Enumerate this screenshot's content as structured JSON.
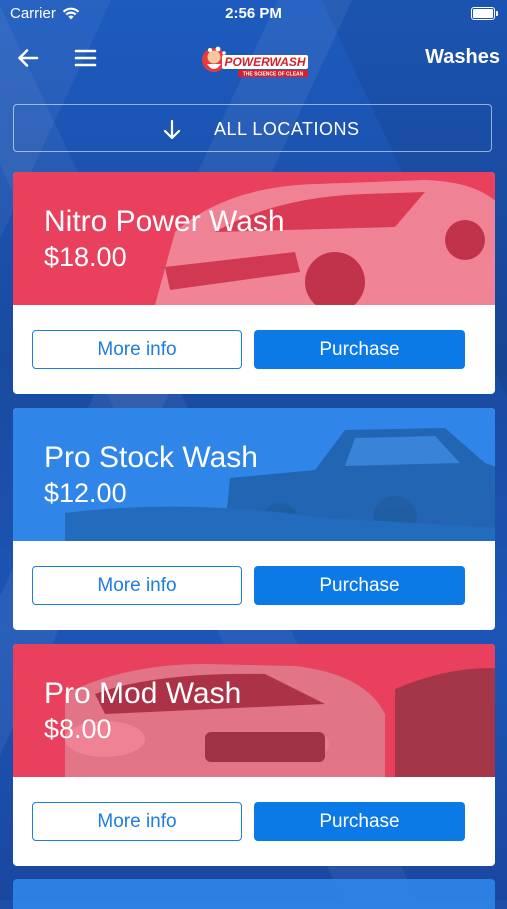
{
  "status_bar": {
    "carrier": "Carrier",
    "time": "2:56 PM"
  },
  "nav": {
    "title": "Washes",
    "logo_text": "POWERWASH",
    "logo_tagline": "THE SCIENCE OF CLEAN"
  },
  "location_filter": {
    "label": "ALL LOCATIONS"
  },
  "washes": [
    {
      "name": "Nitro Power Wash",
      "price": "$18.00",
      "color": "#e8405d",
      "more_info_label": "More info",
      "purchase_label": "Purchase"
    },
    {
      "name": "Pro Stock Wash",
      "price": "$12.00",
      "color": "#2f86e8",
      "more_info_label": "More info",
      "purchase_label": "Purchase"
    },
    {
      "name": "Pro Mod Wash",
      "price": "$8.00",
      "color": "#e8405d",
      "more_info_label": "More info",
      "purchase_label": "Purchase"
    }
  ],
  "icons": {
    "back": "back-arrow-icon",
    "menu": "hamburger-menu-icon",
    "location_arrow": "down-arrow-icon",
    "wifi": "wifi-icon",
    "battery": "battery-icon"
  },
  "colors": {
    "background": "#1e4fa8",
    "card_red": "#e8405d",
    "card_blue": "#2f86e8",
    "primary_button": "#0b7ae6"
  }
}
